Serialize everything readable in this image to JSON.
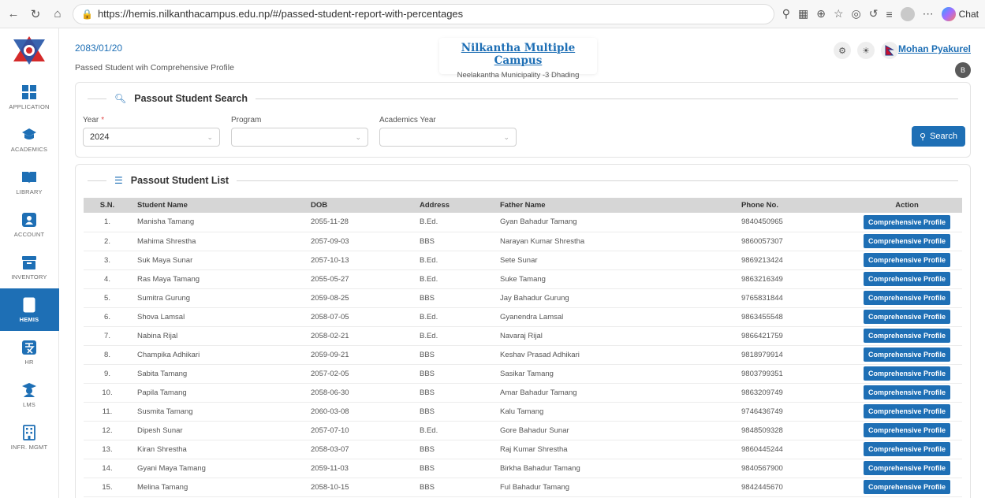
{
  "browser": {
    "url": "https://hemis.nilkanthacampus.edu.np/#/passed-student-report-with-percentages",
    "chat_label": "Chat"
  },
  "sidebar": {
    "items": [
      {
        "label": "APPLICATION",
        "icon": "grid-icon"
      },
      {
        "label": "ACADEMICS",
        "icon": "graduation-cap-icon"
      },
      {
        "label": "LIBRARY",
        "icon": "book-icon"
      },
      {
        "label": "ACCOUNT",
        "icon": "account-icon"
      },
      {
        "label": "INVENTORY",
        "icon": "inventory-icon"
      },
      {
        "label": "HEMIS",
        "icon": "document-icon"
      },
      {
        "label": "HR",
        "icon": "hr-icon"
      },
      {
        "label": "LMS",
        "icon": "teacher-icon"
      },
      {
        "label": "INFR. MGMT",
        "icon": "building-icon"
      }
    ]
  },
  "header": {
    "date": "2083/01/20",
    "subtitle": "Passed Student wih Comprehensive Profile",
    "campus_name": "Nilkantha Multiple Campus",
    "campus_address": "Neelakantha Municipality -3 Dhading",
    "user_name": "Mohan Pyakurel",
    "avatar_letter": "B"
  },
  "search": {
    "title": "Passout Student Search",
    "year_label": "Year",
    "year_value": "2024",
    "program_label": "Program",
    "program_value": "",
    "academic_year_label": "Academics Year",
    "academic_year_value": "",
    "button_label": "Search"
  },
  "list": {
    "title": "Passout Student List",
    "columns": [
      "S.N.",
      "Student Name",
      "DOB",
      "Address",
      "Father Name",
      "Phone No.",
      "Action"
    ],
    "action_label": "Comprehensive Profile",
    "rows": [
      {
        "sn": "1.",
        "name": "Manisha Tamang",
        "dob": "2055-11-28",
        "address": "B.Ed.",
        "father": "Gyan Bahadur Tamang",
        "phone": "9840450965"
      },
      {
        "sn": "2.",
        "name": "Mahima Shrestha",
        "dob": "2057-09-03",
        "address": "BBS",
        "father": "Narayan Kumar Shrestha",
        "phone": "9860057307"
      },
      {
        "sn": "3.",
        "name": "Suk Maya Sunar",
        "dob": "2057-10-13",
        "address": "B.Ed.",
        "father": "Sete Sunar",
        "phone": "9869213424"
      },
      {
        "sn": "4.",
        "name": "Ras Maya Tamang",
        "dob": "2055-05-27",
        "address": "B.Ed.",
        "father": "Suke Tamang",
        "phone": "9863216349"
      },
      {
        "sn": "5.",
        "name": "Sumitra Gurung",
        "dob": "2059-08-25",
        "address": "BBS",
        "father": "Jay Bahadur Gurung",
        "phone": "9765831844"
      },
      {
        "sn": "6.",
        "name": "Shova Lamsal",
        "dob": "2058-07-05",
        "address": "B.Ed.",
        "father": "Gyanendra Lamsal",
        "phone": "9863455548"
      },
      {
        "sn": "7.",
        "name": "Nabina Rijal",
        "dob": "2058-02-21",
        "address": "B.Ed.",
        "father": "Navaraj Rijal",
        "phone": "9866421759"
      },
      {
        "sn": "8.",
        "name": "Champika Adhikari",
        "dob": "2059-09-21",
        "address": "BBS",
        "father": "Keshav Prasad Adhikari",
        "phone": "9818979914"
      },
      {
        "sn": "9.",
        "name": "Sabita Tamang",
        "dob": "2057-02-05",
        "address": "BBS",
        "father": "Sasikar Tamang",
        "phone": "9803799351"
      },
      {
        "sn": "10.",
        "name": "Papila Tamang",
        "dob": "2058-06-30",
        "address": "BBS",
        "father": "Amar Bahadur Tamang",
        "phone": "9863209749"
      },
      {
        "sn": "11.",
        "name": "Susmita Tamang",
        "dob": "2060-03-08",
        "address": "BBS",
        "father": "Kalu Tamang",
        "phone": "9746436749"
      },
      {
        "sn": "12.",
        "name": "Dipesh Sunar",
        "dob": "2057-07-10",
        "address": "B.Ed.",
        "father": "Gore Bahadur Sunar",
        "phone": "9848509328"
      },
      {
        "sn": "13.",
        "name": "Kiran Shrestha",
        "dob": "2058-03-07",
        "address": "BBS",
        "father": "Raj Kumar Shrestha",
        "phone": "9860445244"
      },
      {
        "sn": "14.",
        "name": "Gyani Maya Tamang",
        "dob": "2059-11-03",
        "address": "BBS",
        "father": "Birkha Bahadur Tamang",
        "phone": "9840567900"
      },
      {
        "sn": "15.",
        "name": "Melina Tamang",
        "dob": "2058-10-15",
        "address": "BBS",
        "father": "Ful Bahadur Tamang",
        "phone": "9842445670"
      }
    ]
  },
  "colors": {
    "primary": "#1e6fb5",
    "table_header": "#d6d6d6",
    "required": "#e04848"
  }
}
